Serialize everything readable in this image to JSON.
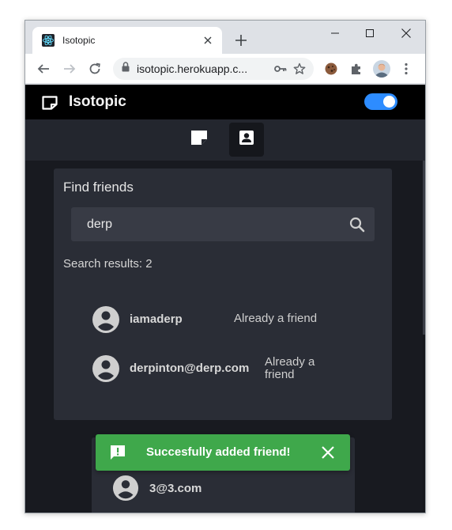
{
  "browser": {
    "tab_title": "Isotopic",
    "url": "isotopic.herokuapp.c...",
    "new_tab": "+",
    "tab_close": "×"
  },
  "app": {
    "title": "Isotopic",
    "dark_mode_enabled": true,
    "nav_tabs": [
      {
        "icon": "note-icon",
        "active": false
      },
      {
        "icon": "contact-card-icon",
        "active": true
      }
    ]
  },
  "find_friends": {
    "title": "Find friends",
    "search_value": "derp",
    "results_label": "Search results: 2",
    "results": [
      {
        "name": "iamaderp",
        "status": "Already a friend"
      },
      {
        "name": "derpinton@derp.com",
        "status": "Already a friend"
      }
    ]
  },
  "friends_list": [
    {
      "name": "3@3.com"
    }
  ],
  "snackbar": {
    "message": "Succesfully added friend!"
  },
  "colors": {
    "page_bg": "#181a20",
    "card_bg": "#2a2d36",
    "accent": "#2d8cff",
    "success": "#3fa84b"
  }
}
